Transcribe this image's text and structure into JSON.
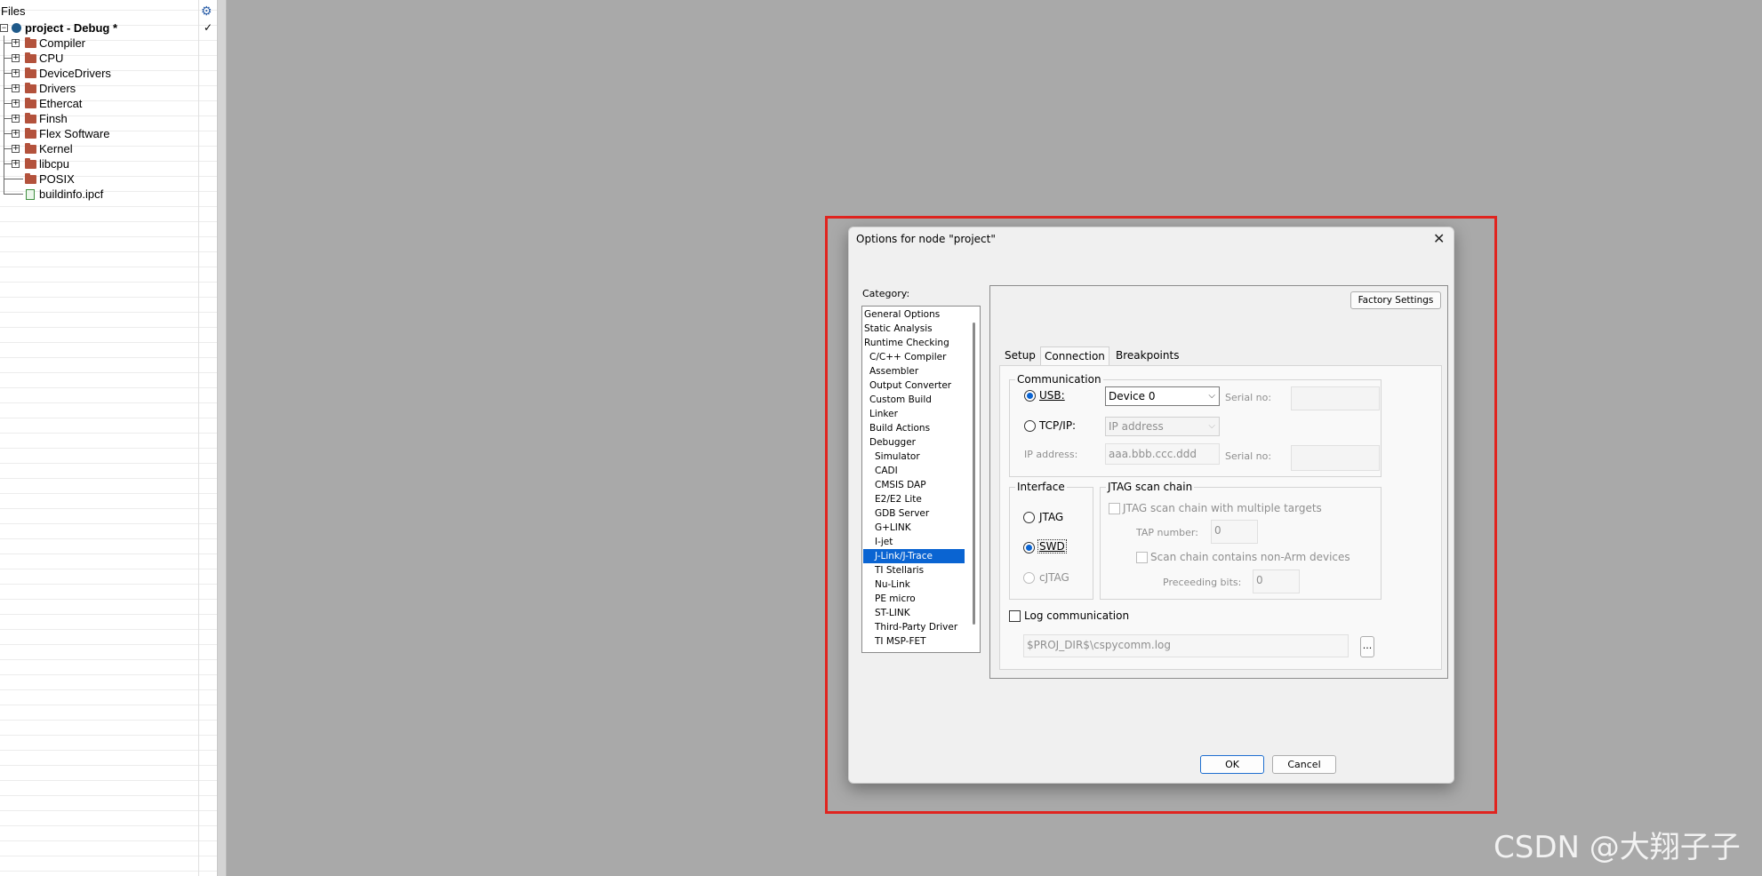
{
  "files_pane": {
    "header": "Files",
    "root": {
      "name": "project - Debug *",
      "status": "✓"
    },
    "items": [
      {
        "name": "Compiler",
        "type": "folder"
      },
      {
        "name": "CPU",
        "type": "folder"
      },
      {
        "name": "DeviceDrivers",
        "type": "folder"
      },
      {
        "name": "Drivers",
        "type": "folder"
      },
      {
        "name": "Ethercat",
        "type": "folder"
      },
      {
        "name": "Finsh",
        "type": "folder"
      },
      {
        "name": "Flex Software",
        "type": "folder"
      },
      {
        "name": "Kernel",
        "type": "folder"
      },
      {
        "name": "libcpu",
        "type": "folder"
      },
      {
        "name": "POSIX",
        "type": "folder"
      },
      {
        "name": "buildinfo.ipcf",
        "type": "file"
      }
    ]
  },
  "dialog": {
    "title": "Options for node \"project\"",
    "close": "✕",
    "category_label": "Category:",
    "categories": [
      "General Options",
      "Static Analysis",
      "Runtime Checking",
      "C/C++ Compiler",
      "Assembler",
      "Output Converter",
      "Custom Build",
      "Linker",
      "Build Actions",
      "Debugger",
      "Simulator",
      "CADI",
      "CMSIS DAP",
      "E2/E2 Lite",
      "GDB Server",
      "G+LINK",
      "I-jet",
      "J-Link/J-Trace",
      "TI Stellaris",
      "Nu-Link",
      "PE micro",
      "ST-LINK",
      "Third-Party Driver",
      "TI MSP-FET"
    ],
    "selected_category": "J-Link/J-Trace",
    "factory_settings": "Factory Settings",
    "tabs": [
      "Setup",
      "Connection",
      "Breakpoints"
    ],
    "active_tab": "Connection",
    "communication": {
      "title": "Communication",
      "usb_label": "USB:",
      "usb_value": "Device 0",
      "serial_no_label": "Serial no:",
      "tcpip_label": "TCP/IP:",
      "tcpip_value": "IP address",
      "ip_address_label": "IP address:",
      "ip_address_value": "aaa.bbb.ccc.ddd",
      "serial_no_label_2": "Serial no:"
    },
    "interface": {
      "title": "Interface",
      "jtag": "JTAG",
      "swd": "SWD",
      "cjtag": "cJTAG",
      "selected": "SWD"
    },
    "jtag_chain": {
      "title": "JTAG scan chain",
      "multi_targets": "JTAG scan chain with multiple targets",
      "tap_number_label": "TAP number:",
      "tap_number_value": "0",
      "non_arm": "Scan chain contains non-Arm devices",
      "preceeding_bits_label": "Preceeding bits:",
      "preceeding_bits_value": "0"
    },
    "log": {
      "label": "Log communication",
      "path": "$PROJ_DIR$\\cspycomm.log",
      "browse": "..."
    },
    "ok": "OK",
    "cancel": "Cancel"
  },
  "watermark": "CSDN @大翔子子",
  "colors": {
    "highlight": "#e0241f",
    "selection": "#0a64d2",
    "background": "#a9a9a9"
  }
}
